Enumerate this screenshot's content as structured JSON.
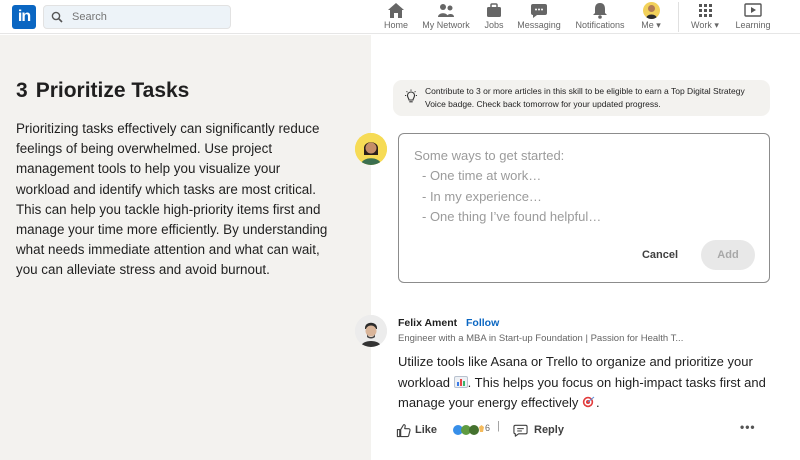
{
  "nav": {
    "logo": "in",
    "search_placeholder": "Search",
    "items": [
      {
        "label": "Home",
        "icon": "home-icon"
      },
      {
        "label": "My Network",
        "icon": "network-icon"
      },
      {
        "label": "Jobs",
        "icon": "briefcase-icon"
      },
      {
        "label": "Messaging",
        "icon": "messaging-icon"
      },
      {
        "label": "Notifications",
        "icon": "bell-icon"
      },
      {
        "label": "Me",
        "icon": "avatar"
      },
      {
        "label": "Work",
        "icon": "grid-icon"
      },
      {
        "label": "Learning",
        "icon": "play-icon"
      }
    ]
  },
  "section": {
    "number": "3",
    "title": "Prioritize Tasks",
    "body": "Prioritizing tasks effectively can significantly reduce feelings of being overwhelmed. Use project management tools to help you visualize your workload and identify which tasks are most critical. This can help you tackle high-priority items first and manage your time more efficiently. By understanding what needs immediate attention and what can wait, you can alleviate stress and avoid burnout."
  },
  "banner": {
    "text": "Contribute to 3 or more articles in this skill to be eligible to earn a Top Digital Strategy Voice badge. Check back tomorrow for your updated progress."
  },
  "editor": {
    "prompt": "Some ways to get started:",
    "suggestions": [
      "- One time at work…",
      "- In my experience…",
      "- One thing I’ve found helpful…"
    ],
    "cancel_label": "Cancel",
    "add_label": "Add"
  },
  "comment": {
    "author": "Felix Ament",
    "follow_label": "Follow",
    "headline": "Engineer with a MBA in Start-up Foundation | Passion for Health T...",
    "text_part1": "Utilize tools like Asana or Trello to organize and prioritize your workload",
    "text_part2": ". This helps you focus on high-impact tasks first and manage your energy effectively",
    "text_part3": ".",
    "like_label": "Like",
    "reaction_count": "6",
    "separator": "|",
    "reply_label": "Reply",
    "more_label": "•••"
  },
  "colors": {
    "brand": "#0a66c2",
    "left_bg": "#f3f2ef"
  }
}
